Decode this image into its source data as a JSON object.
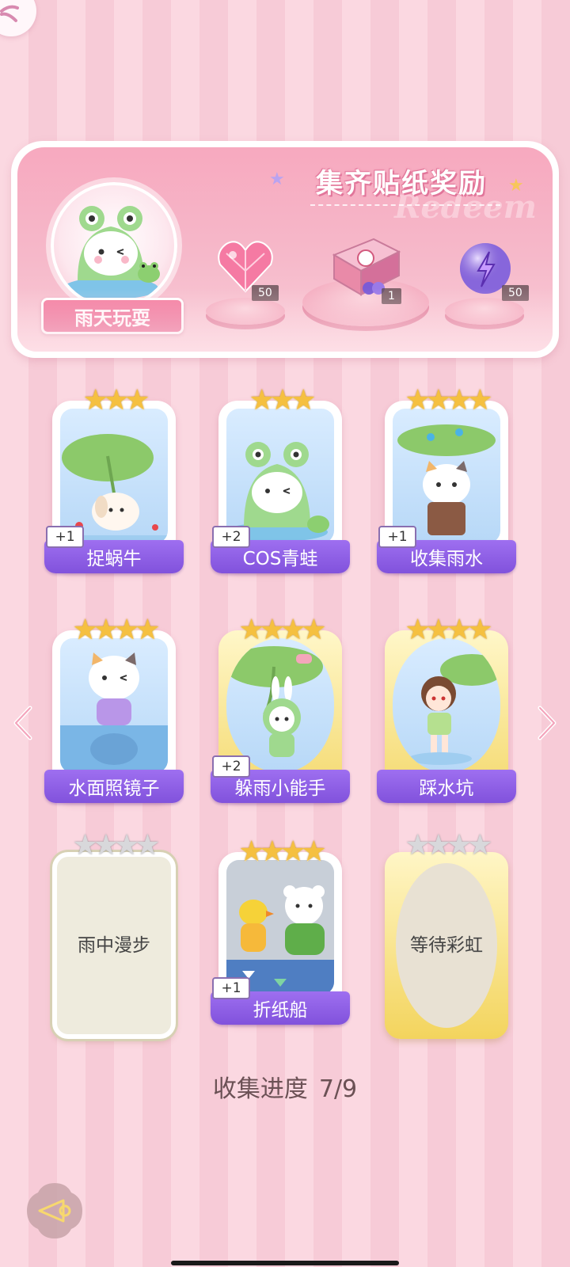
{
  "banner": {
    "title": "集齐贴纸奖励",
    "watermark": "Redeem",
    "theme_label": "雨天玩耍",
    "rewards": [
      {
        "icon": "pink-heart-gem-icon",
        "count": "50"
      },
      {
        "icon": "gift-box-icon",
        "count": "1"
      },
      {
        "icon": "lightning-orb-icon",
        "count": "50"
      }
    ]
  },
  "cards": [
    {
      "name": "捉蜗牛",
      "stars": "★★★",
      "plus": "+1",
      "collected": true
    },
    {
      "name": "COS青蛙",
      "stars": "★★★",
      "plus": "+2",
      "collected": true
    },
    {
      "name": "收集雨水",
      "stars": "★★★★",
      "plus": "+1",
      "collected": true
    },
    {
      "name": "水面照镜子",
      "stars": "★★★★",
      "plus": "",
      "collected": true
    },
    {
      "name": "躲雨小能手",
      "stars": "★★★★",
      "plus": "+2",
      "collected": true
    },
    {
      "name": "踩水坑",
      "stars": "★★★★",
      "plus": "",
      "collected": true
    },
    {
      "name": "雨中漫步",
      "stars": "★★★★",
      "plus": "",
      "collected": false
    },
    {
      "name": "折纸船",
      "stars": "★★★★",
      "plus": "+1",
      "collected": true
    },
    {
      "name": "等待彩虹",
      "stars": "★★★★",
      "plus": "",
      "collected": false
    }
  ],
  "progress": {
    "label": "收集进度",
    "value": "7/9"
  }
}
